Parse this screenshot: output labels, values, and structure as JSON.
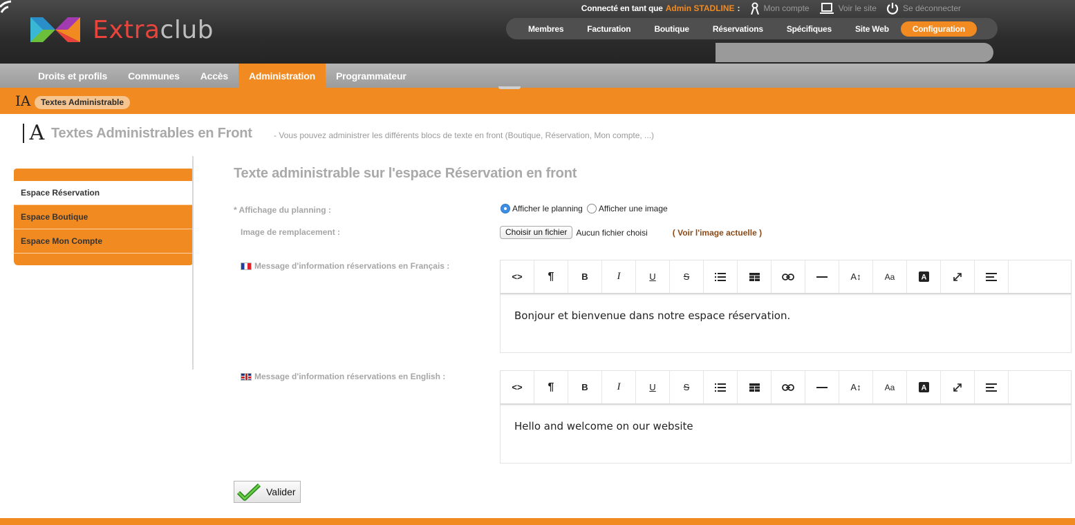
{
  "brand": {
    "name_part1": "Extra",
    "name_part2": "club"
  },
  "user": {
    "connected_as": "Connecté en tant que",
    "admin_name": "Admin STADLINE",
    "separator": ":",
    "links": [
      {
        "label": "Mon compte",
        "icon": "user-icon"
      },
      {
        "label": "Voir le site",
        "icon": "monitor-icon"
      },
      {
        "label": "Se déconnecter",
        "icon": "power-icon"
      }
    ]
  },
  "main_nav": [
    {
      "label": "Membres"
    },
    {
      "label": "Facturation"
    },
    {
      "label": "Boutique"
    },
    {
      "label": "Réservations"
    },
    {
      "label": "Spécifiques"
    },
    {
      "label": "Site Web"
    },
    {
      "label": "Configuration",
      "active": true
    }
  ],
  "sub_nav": [
    {
      "label": "Droits et profils"
    },
    {
      "label": "Communes"
    },
    {
      "label": "Accès"
    },
    {
      "label": "Administration",
      "active": true
    },
    {
      "label": "Programmateur"
    }
  ],
  "breadcrumb": {
    "icon": "text-admin-icon",
    "label": "Textes Administrable"
  },
  "page": {
    "title": "Textes Administrables en Front",
    "description": "- Vous pouvez administrer les différents blocs de texte en front (Boutique, Réservation, Mon compte, ...)"
  },
  "side_menu": [
    {
      "label": "Espace Réservation",
      "active": true
    },
    {
      "label": "Espace Boutique"
    },
    {
      "label": "Espace Mon Compte"
    }
  ],
  "form": {
    "title": "Texte administrable sur l'espace Réservation en front",
    "planning_label": "* Affichage du planning :",
    "radio_planning": "Afficher le planning",
    "radio_image": "Afficher une image",
    "radio_selected": "Afficher le planning",
    "image_label": "Image de remplacement :",
    "file_button": "Choisir un fichier",
    "no_file": "Aucun fichier choisi",
    "see_image": "( Voir l'image actuelle )",
    "fr_label": "Message d'information réservations en Français :",
    "en_label": "Message d'information réservations en English :",
    "fr_text": "Bonjour et bienvenue dans notre espace réservation.",
    "en_text": "Hello and welcome on our website",
    "submit": "Valider"
  },
  "toolbar_buttons": [
    {
      "name": "code-view-icon"
    },
    {
      "name": "paragraph-icon"
    },
    {
      "name": "bold-icon"
    },
    {
      "name": "italic-icon"
    },
    {
      "name": "underline-icon"
    },
    {
      "name": "strikethrough-icon"
    },
    {
      "name": "bullet-list-icon"
    },
    {
      "name": "table-icon"
    },
    {
      "name": "link-icon"
    },
    {
      "name": "horizontal-rule-icon"
    },
    {
      "name": "font-size-icon"
    },
    {
      "name": "font-case-icon"
    },
    {
      "name": "text-color-icon"
    },
    {
      "name": "fullscreen-icon"
    },
    {
      "name": "align-icon"
    }
  ],
  "colors": {
    "accent": "#f18a21",
    "header_dark": "#2c2c2c",
    "subnav_grey": "#a8a8a8"
  }
}
